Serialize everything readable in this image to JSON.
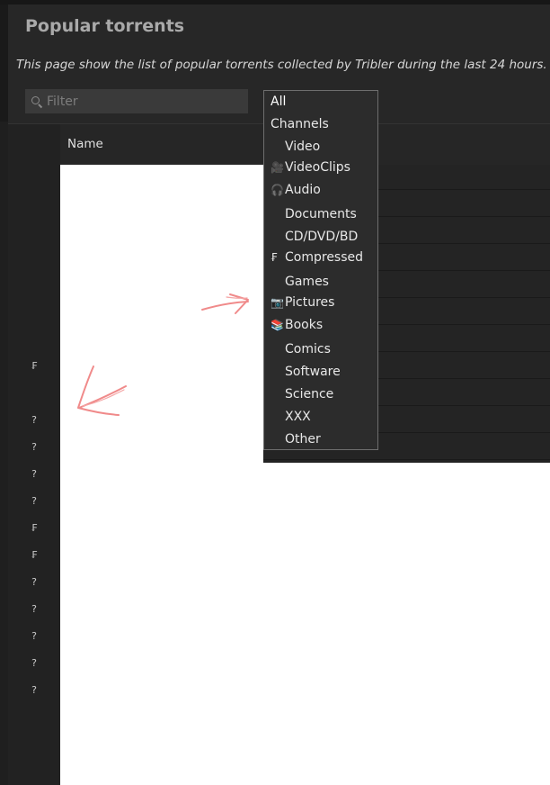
{
  "header": {
    "title": "Popular torrents",
    "subtitle": "This page show the list of popular torrents collected by Tribler during the last 24 hours."
  },
  "filter": {
    "placeholder": "Filter",
    "value": ""
  },
  "table": {
    "columns": [
      "Name"
    ],
    "row_icons": [
      "",
      "",
      "",
      "",
      "",
      "",
      "",
      "₣",
      "",
      "?",
      "?",
      "?",
      "?",
      "₣",
      "₣",
      "?",
      "?",
      "?",
      "?",
      "?",
      "",
      "",
      ""
    ]
  },
  "category_dropdown": {
    "selected": "All",
    "options": [
      {
        "icon": "",
        "label": "All"
      },
      {
        "icon": "",
        "label": "Channels"
      },
      {
        "icon": "",
        "label": "Video"
      },
      {
        "icon": "🎥",
        "label": "VideoClips"
      },
      {
        "icon": "🎧",
        "label": "Audio"
      },
      {
        "icon": "",
        "label": "Documents"
      },
      {
        "icon": "",
        "label": "CD/DVD/BD"
      },
      {
        "icon": "₣",
        "label": "Compressed"
      },
      {
        "icon": "",
        "label": "Games"
      },
      {
        "icon": "📷",
        "label": "Pictures"
      },
      {
        "icon": "📚",
        "label": "Books"
      },
      {
        "icon": "",
        "label": "Comics"
      },
      {
        "icon": "",
        "label": "Software"
      },
      {
        "icon": "",
        "label": "Science"
      },
      {
        "icon": "",
        "label": "XXX"
      },
      {
        "icon": "",
        "label": "Other"
      }
    ]
  },
  "colors": {
    "background": "#272727",
    "title": "#a9a9a9",
    "annotation_arrow": "#f08a8a"
  }
}
